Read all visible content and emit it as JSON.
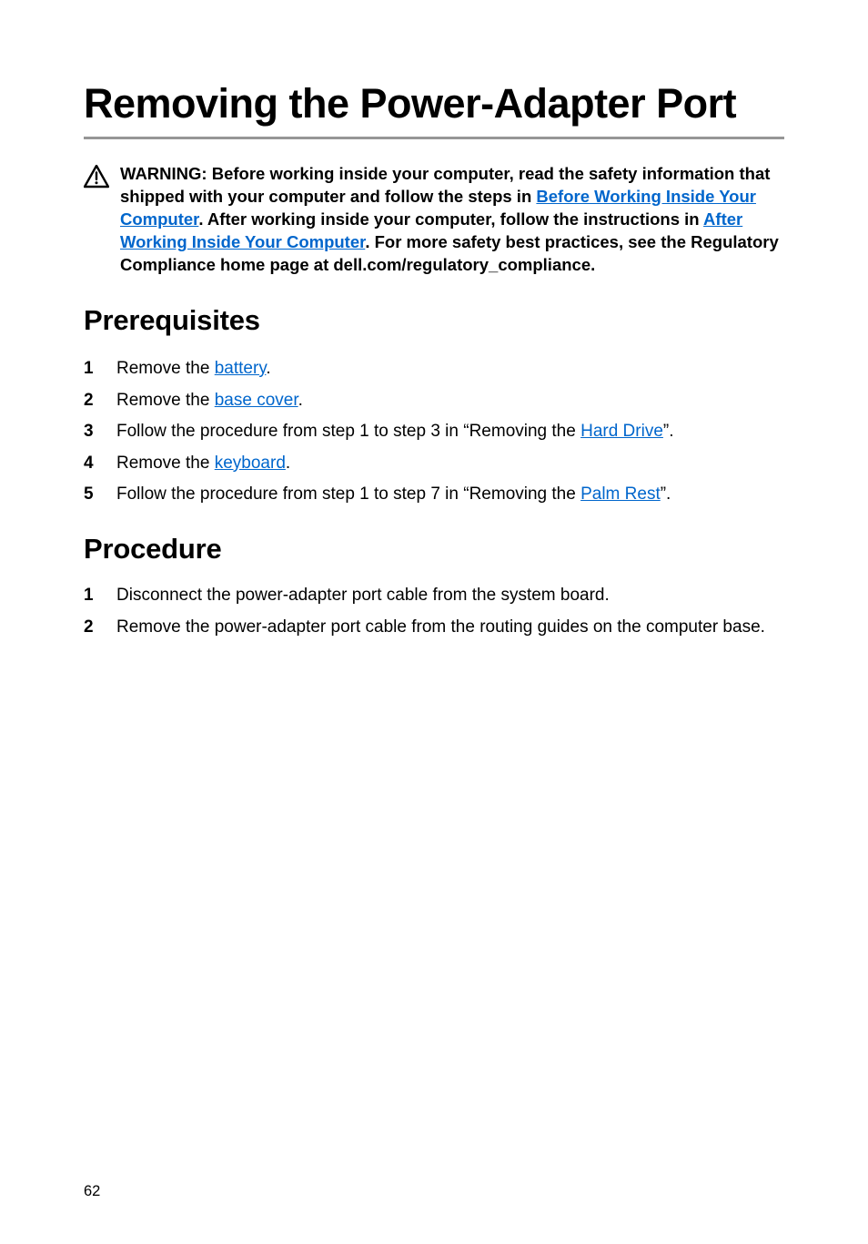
{
  "title": "Removing the Power-Adapter Port",
  "warning": {
    "prefix": "WARNING: Before working inside your computer, read the safety information that shipped with your computer and follow the steps in ",
    "link1": "Before Working Inside Your Computer",
    "mid1": ". After working inside your computer, follow the instructions in ",
    "link2": "After Working Inside Your Computer",
    "mid2": ". For more safety best practices, see the Regulatory Compliance home page at dell.com/regulatory_compliance."
  },
  "prereq": {
    "heading": "Prerequisites",
    "items": [
      {
        "num": "1",
        "before": "Remove the ",
        "link": "battery",
        "after": "."
      },
      {
        "num": "2",
        "before": "Remove the ",
        "link": "base cover",
        "after": "."
      },
      {
        "num": "3",
        "before": "Follow the procedure from step 1 to step 3 in “Removing the ",
        "link": "Hard Drive",
        "after": "”."
      },
      {
        "num": "4",
        "before": "Remove the ",
        "link": "keyboard",
        "after": "."
      },
      {
        "num": "5",
        "before": "Follow the procedure from step 1 to step 7 in “Removing the ",
        "link": "Palm Rest",
        "after": "”."
      }
    ]
  },
  "procedure": {
    "heading": "Procedure",
    "items": [
      {
        "num": "1",
        "text": "Disconnect the power-adapter port cable from the system board."
      },
      {
        "num": "2",
        "text": "Remove the power-adapter port cable from the routing guides on the computer base."
      }
    ]
  },
  "page_number": "62"
}
